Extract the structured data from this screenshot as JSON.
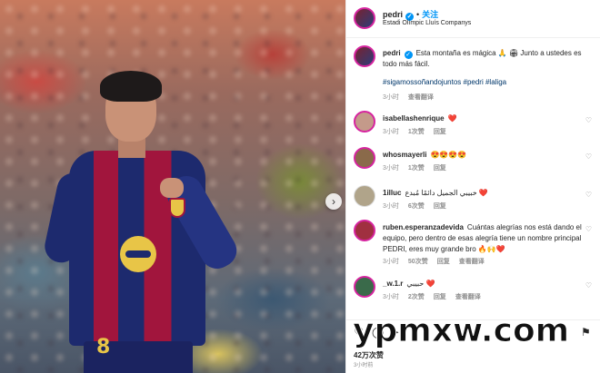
{
  "header": {
    "username": "pedri",
    "follow_label": "关注",
    "location": "Estadi Olímpic Lluís Companys"
  },
  "caption": {
    "username": "pedri",
    "text": "Esta montaña es mágica 🙏 🏟 Junto a ustedes es todo más fácil.",
    "hashtags": "#sigamossoñandojuntos #pedri #laliga",
    "time": "3小时",
    "translate_label": "查看翻译"
  },
  "comments": [
    {
      "username": "isabellashenrique",
      "text": "❤️",
      "time": "3小时",
      "likes": "1次赞",
      "reply": "回复",
      "extra": ""
    },
    {
      "username": "whosmayerli",
      "text": "😍😍😍😍",
      "time": "3小时",
      "likes": "1次赞",
      "reply": "回复",
      "extra": ""
    },
    {
      "username": "1illuc",
      "text": "خبيبي الجميل دائمًا مُبدع ❤️",
      "time": "3小时",
      "likes": "6次赞",
      "reply": "回复",
      "extra": ""
    },
    {
      "username": "ruben.esperanzadevida",
      "text": "Cuántas alegrías nos está dando el equipo, pero dentro de esas alegría tiene un nombre principal PEDRI, eres muy grande bro 🔥🙌❤️",
      "time": "3小时",
      "likes": "50次赞",
      "reply": "回复",
      "extra": "查看翻译"
    },
    {
      "username": "_w.1.r",
      "text": "حبيبي ❤️",
      "time": "3小时",
      "likes": "2次赞",
      "reply": "回复",
      "extra": "查看翻译"
    }
  ],
  "footer": {
    "likes": "42万次赞",
    "posted": "3小时前"
  },
  "watermark": "ypmxw.com",
  "icons": {
    "verified": "verified-badge-icon",
    "heart": "heart-icon",
    "comment": "comment-icon",
    "share": "share-icon",
    "save": "save-icon",
    "next": "chevron-right-icon"
  },
  "colors": {
    "link": "#0095f6",
    "hashtag": "#00376b",
    "like": "#ed4956",
    "muted": "#8e8e8e"
  }
}
